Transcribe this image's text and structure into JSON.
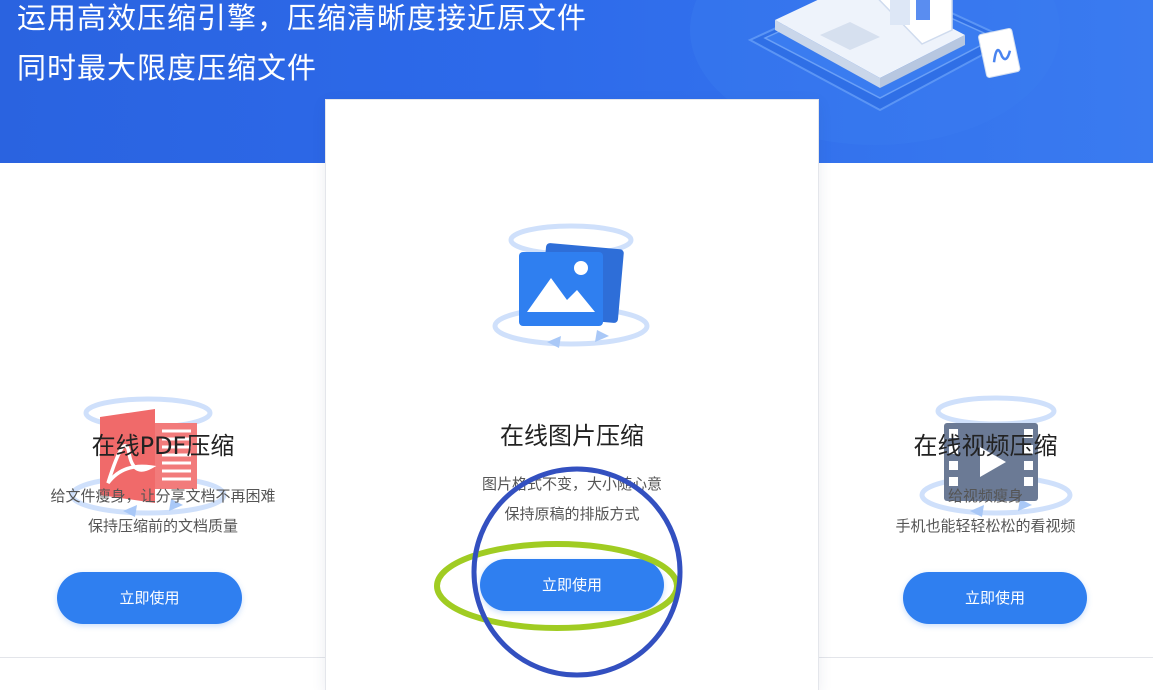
{
  "hero": {
    "line1": "运用高效压缩引擎，压缩清晰度接近原文件",
    "line2": "同时最大限度压缩文件"
  },
  "cards": [
    {
      "title": "在线PDF压缩",
      "desc1": "给文件瘦身，让分享文档不再困难",
      "desc2": "保持压缩前的文档质量",
      "button": "立即使用",
      "icon": "pdf-icon",
      "icon_color": "#f06a6a"
    },
    {
      "title": "在线图片压缩",
      "desc1": "图片格式不变，大小随心意",
      "desc2": "保持原稿的排版方式",
      "button": "立即使用",
      "icon": "image-icon",
      "icon_color": "#2f7ff0"
    },
    {
      "title": "在线视频压缩",
      "desc1": "给视频瘦身",
      "desc2": "手机也能轻轻松松的看视频",
      "button": "立即使用",
      "icon": "video-icon",
      "icon_color": "#6b7a95"
    }
  ],
  "colors": {
    "hero_blue": "#2d6aea",
    "button_blue": "#2f7ff0",
    "annotation_green": "#a0cc22",
    "annotation_navy": "#3350c0"
  }
}
